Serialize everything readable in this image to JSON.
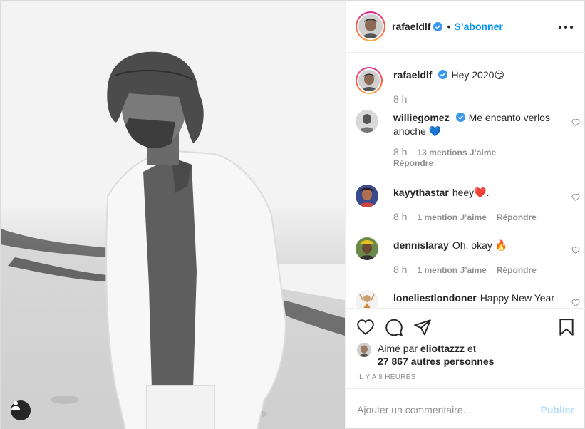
{
  "post": {
    "author": {
      "username": "rafaeldlf",
      "verified": true,
      "follow_label": "S’abonner",
      "separator": "•"
    },
    "more_icon": "more-horizontal-icon"
  },
  "caption": {
    "username": "rafaeldlf",
    "text": "Hey 2020😏",
    "time": "8 h"
  },
  "comments": [
    {
      "username": "williegomez",
      "verified": true,
      "text": "Me encanto verlos anoche 💙",
      "time": "8 h",
      "likes": "13 mentions J’aime",
      "reply": "Répondre"
    },
    {
      "username": "kayythastar",
      "verified": false,
      "text": "heey❤️.",
      "time": "8 h",
      "likes": "1 mention J’aime",
      "reply": "Répondre"
    },
    {
      "username": "dennislaray",
      "verified": false,
      "text": "Oh, okay 🔥",
      "time": "8 h",
      "likes": "1 mention J’aime",
      "reply": "Répondre"
    },
    {
      "username": "loneliestlondoner",
      "verified": false,
      "text": "Happy New Year",
      "time": "",
      "likes": "",
      "reply": ""
    }
  ],
  "actions": {
    "like_icon": "heart-icon",
    "comment_icon": "comment-icon",
    "share_icon": "paper-plane-icon",
    "save_icon": "bookmark-icon"
  },
  "liked_by": {
    "prefix": "Aimé par",
    "username": "eliottazzz",
    "conjunction": "et",
    "others": "27 867 autres personnes"
  },
  "time_ago": "IL Y A 8 HEURES",
  "add_comment": {
    "placeholder": "Ajouter un commentaire...",
    "publish_label": "Publier"
  },
  "colors": {
    "accent": "#0095f6",
    "publish_disabled": "#b2dffc",
    "verified": "#3897f0",
    "muted": "#8e8e8e"
  }
}
